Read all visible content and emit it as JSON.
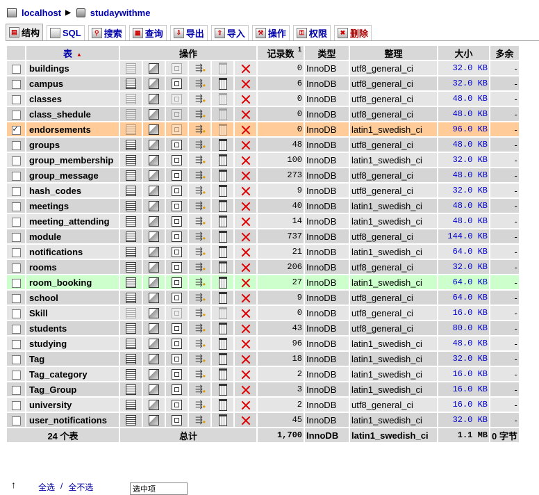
{
  "breadcrumb": {
    "server": "localhost",
    "database": "studaywithme"
  },
  "tabs": [
    {
      "label": "结构",
      "icon": "structure-icon",
      "active": true
    },
    {
      "label": "SQL",
      "icon": "sql-icon",
      "active": false
    },
    {
      "label": "搜索",
      "icon": "search-icon",
      "active": false
    },
    {
      "label": "查询",
      "icon": "query-icon",
      "active": false
    },
    {
      "label": "导出",
      "icon": "export-icon",
      "active": false
    },
    {
      "label": "导入",
      "icon": "import-icon",
      "active": false
    },
    {
      "label": "操作",
      "icon": "operations-icon",
      "active": false
    },
    {
      "label": "权限",
      "icon": "privileges-icon",
      "active": false
    },
    {
      "label": "删除",
      "icon": "drop-icon",
      "active": false
    }
  ],
  "table": {
    "headers": {
      "table": "表",
      "action": "操作",
      "records": "记录数",
      "records_note": "1",
      "type": "类型",
      "collation": "整理",
      "size": "大小",
      "overhead": "多余"
    },
    "rows": [
      {
        "name": "buildings",
        "records": "0",
        "type": "InnoDB",
        "collation": "utf8_general_ci",
        "size": "32.0 KB",
        "overhead": "-",
        "checked": false,
        "state": "odd"
      },
      {
        "name": "campus",
        "records": "6",
        "type": "InnoDB",
        "collation": "utf8_general_ci",
        "size": "32.0 KB",
        "overhead": "-",
        "checked": false,
        "state": "even"
      },
      {
        "name": "classes",
        "records": "0",
        "type": "InnoDB",
        "collation": "utf8_general_ci",
        "size": "48.0 KB",
        "overhead": "-",
        "checked": false,
        "state": "odd"
      },
      {
        "name": "class_shedule",
        "records": "0",
        "type": "InnoDB",
        "collation": "utf8_general_ci",
        "size": "48.0 KB",
        "overhead": "-",
        "checked": false,
        "state": "even"
      },
      {
        "name": "endorsements",
        "records": "0",
        "type": "InnoDB",
        "collation": "latin1_swedish_ci",
        "size": "96.0 KB",
        "overhead": "-",
        "checked": true,
        "state": "marked"
      },
      {
        "name": "groups",
        "records": "48",
        "type": "InnoDB",
        "collation": "utf8_general_ci",
        "size": "48.0 KB",
        "overhead": "-",
        "checked": false,
        "state": "even"
      },
      {
        "name": "group_membership",
        "records": "100",
        "type": "InnoDB",
        "collation": "latin1_swedish_ci",
        "size": "32.0 KB",
        "overhead": "-",
        "checked": false,
        "state": "odd"
      },
      {
        "name": "group_message",
        "records": "273",
        "type": "InnoDB",
        "collation": "utf8_general_ci",
        "size": "48.0 KB",
        "overhead": "-",
        "checked": false,
        "state": "even"
      },
      {
        "name": "hash_codes",
        "records": "9",
        "type": "InnoDB",
        "collation": "utf8_general_ci",
        "size": "32.0 KB",
        "overhead": "-",
        "checked": false,
        "state": "odd"
      },
      {
        "name": "meetings",
        "records": "40",
        "type": "InnoDB",
        "collation": "latin1_swedish_ci",
        "size": "48.0 KB",
        "overhead": "-",
        "checked": false,
        "state": "even"
      },
      {
        "name": "meeting_attending",
        "records": "14",
        "type": "InnoDB",
        "collation": "latin1_swedish_ci",
        "size": "48.0 KB",
        "overhead": "-",
        "checked": false,
        "state": "odd"
      },
      {
        "name": "module",
        "records": "737",
        "type": "InnoDB",
        "collation": "utf8_general_ci",
        "size": "144.0 KB",
        "overhead": "-",
        "checked": false,
        "state": "even"
      },
      {
        "name": "notifications",
        "records": "21",
        "type": "InnoDB",
        "collation": "latin1_swedish_ci",
        "size": "64.0 KB",
        "overhead": "-",
        "checked": false,
        "state": "odd"
      },
      {
        "name": "rooms",
        "records": "206",
        "type": "InnoDB",
        "collation": "utf8_general_ci",
        "size": "32.0 KB",
        "overhead": "-",
        "checked": false,
        "state": "even"
      },
      {
        "name": "room_booking",
        "records": "27",
        "type": "InnoDB",
        "collation": "latin1_swedish_ci",
        "size": "64.0 KB",
        "overhead": "-",
        "checked": false,
        "state": "hover"
      },
      {
        "name": "school",
        "records": "9",
        "type": "InnoDB",
        "collation": "utf8_general_ci",
        "size": "64.0 KB",
        "overhead": "-",
        "checked": false,
        "state": "even"
      },
      {
        "name": "Skill",
        "records": "0",
        "type": "InnoDB",
        "collation": "utf8_general_ci",
        "size": "16.0 KB",
        "overhead": "-",
        "checked": false,
        "state": "odd"
      },
      {
        "name": "students",
        "records": "43",
        "type": "InnoDB",
        "collation": "utf8_general_ci",
        "size": "80.0 KB",
        "overhead": "-",
        "checked": false,
        "state": "even"
      },
      {
        "name": "studying",
        "records": "96",
        "type": "InnoDB",
        "collation": "latin1_swedish_ci",
        "size": "48.0 KB",
        "overhead": "-",
        "checked": false,
        "state": "odd"
      },
      {
        "name": "Tag",
        "records": "18",
        "type": "InnoDB",
        "collation": "latin1_swedish_ci",
        "size": "32.0 KB",
        "overhead": "-",
        "checked": false,
        "state": "even"
      },
      {
        "name": "Tag_category",
        "records": "2",
        "type": "InnoDB",
        "collation": "latin1_swedish_ci",
        "size": "16.0 KB",
        "overhead": "-",
        "checked": false,
        "state": "odd"
      },
      {
        "name": "Tag_Group",
        "records": "3",
        "type": "InnoDB",
        "collation": "latin1_swedish_ci",
        "size": "16.0 KB",
        "overhead": "-",
        "checked": false,
        "state": "even"
      },
      {
        "name": "university",
        "records": "2",
        "type": "InnoDB",
        "collation": "utf8_general_ci",
        "size": "16.0 KB",
        "overhead": "-",
        "checked": false,
        "state": "odd"
      },
      {
        "name": "user_notifications",
        "records": "45",
        "type": "InnoDB",
        "collation": "latin1_swedish_ci",
        "size": "32.0 KB",
        "overhead": "-",
        "checked": false,
        "state": "even"
      }
    ],
    "footer": {
      "count": "24 个表",
      "total_label": "总计",
      "records": "1,700",
      "type": "InnoDB",
      "collation": "latin1_swedish_ci",
      "size": "1.1 MB",
      "overhead": "0 字节"
    }
  },
  "bottom": {
    "check_all": "全选",
    "separator": "/",
    "uncheck_all": "全不选",
    "with_selected": "选中项"
  }
}
